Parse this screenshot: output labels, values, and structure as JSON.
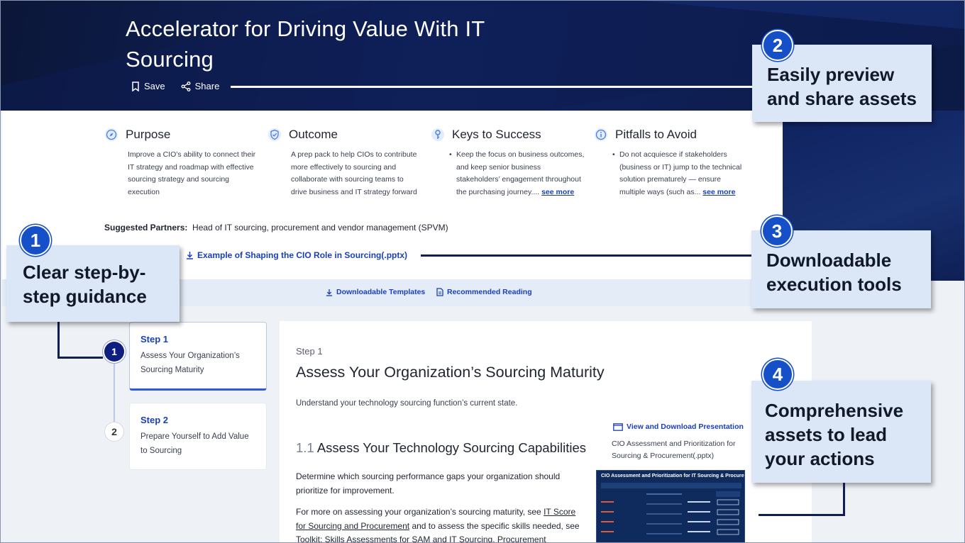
{
  "header": {
    "title": "Accelerator for Driving Value With IT Sourcing",
    "save_label": "Save",
    "share_label": "Share"
  },
  "overview": [
    {
      "heading": "Purpose",
      "icon": "compass-icon",
      "text": "Improve a CIO’s ability to connect their IT strategy and roadmap with effective sourcing strategy and sourcing execution"
    },
    {
      "heading": "Outcome",
      "icon": "shield-check-icon",
      "text": "A prep pack to help CIOs to contribute more effectively to sourcing and collaborate with sourcing teams to drive business and IT strategy forward"
    },
    {
      "heading": "Keys to Success",
      "icon": "key-icon",
      "bullet": "Keep the focus on business outcomes, and keep senior business stakeholders’ engagement throughout the purchasing journey....",
      "see_more": "see more"
    },
    {
      "heading": "Pitfalls to Avoid",
      "icon": "info-icon",
      "bullet": "Do not acquiesce if stakeholders (business or IT) jump to the technical solution prematurely — ensure multiple ways (such as...",
      "see_more": "see more"
    }
  ],
  "partners": {
    "label": "Suggested Partners:",
    "value": "Head of IT sourcing, procurement and vendor management (SPVM)"
  },
  "download": {
    "label": "Example of Shaping the CIO Role in Sourcing(.pptx)"
  },
  "tabs": {
    "templates": "Downloadable Templates",
    "reading": "Recommended Reading"
  },
  "steps": [
    {
      "num": "1",
      "label": "Step 1",
      "desc": "Assess Your Organization’s Sourcing Maturity",
      "active": true
    },
    {
      "num": "2",
      "label": "Step 2",
      "desc": "Prepare Yourself to Add Value to Sourcing",
      "active": false
    }
  ],
  "content": {
    "step_label": "Step 1",
    "title": "Assess Your Organization’s Sourcing Maturity",
    "intro": "Understand your technology sourcing function’s current state.",
    "sub_num": "1.1",
    "sub_title": "Assess Your Technology Sourcing Capabilities",
    "para1": "Determine which sourcing performance gaps your organization should prioritize for improvement.",
    "para2_a": "For more on assessing your organization’s sourcing maturity, see",
    "para2_link1": "IT Score for Sourcing and Procurement",
    "para2_b": "and to assess the specific skills needed,",
    "para2_c": "see Toolkit: Skills Assessments for SAM and IT Sourcing, Procurement",
    "view_link": "View and Download Presentation",
    "view_file": "CIO Assessment and Prioritization for Sourcing & Procurement(.pptx)",
    "thumb_title": "CIO Assessment and Prioritization for IT Sourcing & Procurement"
  },
  "callouts": {
    "c1_num": "1",
    "c1_text": "Clear step-by-step guidance",
    "c2_num": "2",
    "c2_text": "Easily preview and share assets",
    "c3_num": "3",
    "c3_text": "Downloadable execution tools",
    "c4_num": "4",
    "c4_text": "Comprehensive assets to lead your actions"
  },
  "colors": {
    "accent_blue": "#1650c8",
    "link_blue": "#1a3fb8",
    "hero_navy": "#0b1638",
    "callout_bg": "#dbe7f6"
  }
}
